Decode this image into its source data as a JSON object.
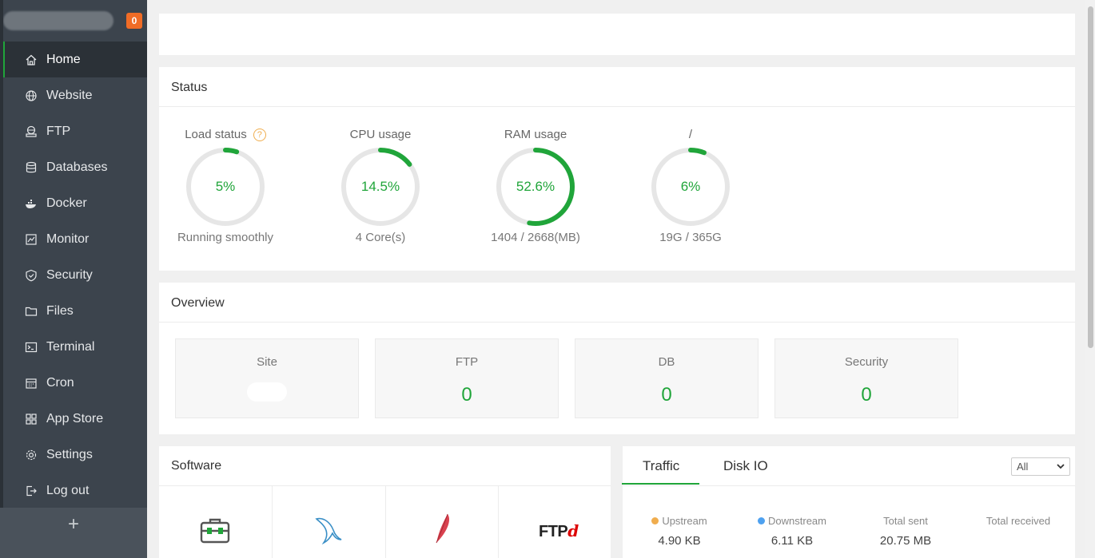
{
  "sidebar": {
    "badge": "0",
    "items": [
      {
        "label": "Home",
        "icon": "home-icon"
      },
      {
        "label": "Website",
        "icon": "globe-icon"
      },
      {
        "label": "FTP",
        "icon": "ftp-icon"
      },
      {
        "label": "Databases",
        "icon": "database-icon"
      },
      {
        "label": "Docker",
        "icon": "docker-icon"
      },
      {
        "label": "Monitor",
        "icon": "monitor-icon"
      },
      {
        "label": "Security",
        "icon": "shield-icon"
      },
      {
        "label": "Files",
        "icon": "folder-icon"
      },
      {
        "label": "Terminal",
        "icon": "terminal-icon"
      },
      {
        "label": "Cron",
        "icon": "calendar-icon"
      },
      {
        "label": "App Store",
        "icon": "grid-icon"
      },
      {
        "label": "Settings",
        "icon": "gear-icon"
      },
      {
        "label": "Log out",
        "icon": "logout-icon"
      }
    ],
    "add": "+"
  },
  "status": {
    "title": "Status",
    "gauges": [
      {
        "label": "Load status",
        "value": "5%",
        "fraction": 0.05,
        "sub": "Running smoothly"
      },
      {
        "label": "CPU usage",
        "value": "14.5%",
        "fraction": 0.145,
        "sub": "4 Core(s)"
      },
      {
        "label": "RAM usage",
        "value": "52.6%",
        "fraction": 0.526,
        "sub": "1404 / 2668(MB)"
      },
      {
        "label": "/",
        "value": "6%",
        "fraction": 0.06,
        "sub": "19G / 365G"
      }
    ],
    "help": "?"
  },
  "overview": {
    "title": "Overview",
    "cards": [
      {
        "label": "Site",
        "value": ""
      },
      {
        "label": "FTP",
        "value": "0"
      },
      {
        "label": "DB",
        "value": "0"
      },
      {
        "label": "Security",
        "value": "0"
      }
    ]
  },
  "software": {
    "title": "Software",
    "items": [
      "toolbox-icon",
      "mysql-icon",
      "feather-icon",
      "ftpd-icon"
    ],
    "ftpd_text": "FTP",
    "ftpd_suffix": "d"
  },
  "traffic": {
    "tabs": [
      "Traffic",
      "Disk IO"
    ],
    "select": "All",
    "columns": [
      {
        "label": "Upstream",
        "value": "4.90 KB",
        "dot": "#f0ad4e"
      },
      {
        "label": "Downstream",
        "value": "6.11 KB",
        "dot": "#4ea1f0"
      },
      {
        "label": "Total sent",
        "value": "20.75 MB"
      },
      {
        "label": "Total received",
        "value": ""
      }
    ]
  },
  "colors": {
    "accent": "#20a53a",
    "sidebar": "#3c444d",
    "badge": "#f06c26",
    "ring": "#e6e6e6"
  }
}
